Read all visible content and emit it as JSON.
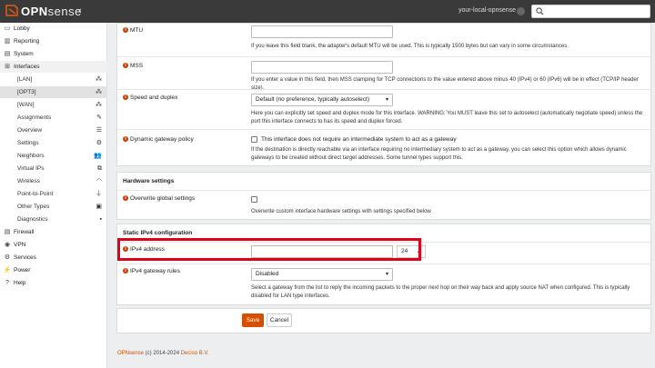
{
  "header": {
    "logo_text_bold": "OPN",
    "logo_text_thin": "sense",
    "hostname": "your-local-opnsense",
    "search_placeholder": ""
  },
  "sidebar": {
    "items": [
      {
        "label": "Lobby",
        "icon": "laptop-icon"
      },
      {
        "label": "Reporting",
        "icon": "bar-chart-icon"
      },
      {
        "label": "System",
        "icon": "server-icon"
      },
      {
        "label": "Interfaces",
        "icon": "sitemap-icon"
      },
      {
        "label": "[LAN]",
        "icon": "sitemap-icon"
      },
      {
        "label": "[OPT3]",
        "icon": "sitemap-icon"
      },
      {
        "label": "[WAN]",
        "icon": "sitemap-icon"
      },
      {
        "label": "Assignments",
        "icon": "pencil-icon"
      },
      {
        "label": "Overview",
        "icon": "tasks-icon"
      },
      {
        "label": "Settings",
        "icon": "cogs-icon"
      },
      {
        "label": "Neighbors",
        "icon": "users-icon"
      },
      {
        "label": "Virtual IPs",
        "icon": "clone-icon"
      },
      {
        "label": "Wireless",
        "icon": "wifi-icon"
      },
      {
        "label": "Point-to-Point",
        "icon": "plug-icon"
      },
      {
        "label": "Other Types",
        "icon": "archive-icon"
      },
      {
        "label": "Diagnostics",
        "icon": "medkit-icon"
      },
      {
        "label": "Firewall",
        "icon": "fire-icon"
      },
      {
        "label": "VPN",
        "icon": "globe-icon"
      },
      {
        "label": "Services",
        "icon": "cog-icon"
      },
      {
        "label": "Power",
        "icon": "plug-icon"
      },
      {
        "label": "Help",
        "icon": "help-icon"
      }
    ]
  },
  "form": {
    "mtu": {
      "label": "MTU",
      "value": "",
      "help": "If you leave this field blank, the adapter's default MTU will be used. This is typically 1500 bytes but can vary in some circumstances."
    },
    "mss": {
      "label": "MSS",
      "value": "",
      "help": "If you enter a value in this field, then MSS clamping for TCP connections to the value entered above minus 40 (IPv4) or 60 (IPv6) will be in effect (TCP/IP header size)."
    },
    "speed": {
      "label": "Speed and duplex",
      "selected": "Default (no preference, typically autoselect)",
      "help": "Here you can explicitly set speed and duplex mode for this interface. WARNING: You MUST leave this set to autoselect (automatically negotiate speed) unless the port this interface connects to has its speed and duplex forced."
    },
    "dyn_gw": {
      "label": "Dynamic gateway policy",
      "checkbox_label": "This interface does not require an intermediate system to act as a gateway",
      "help": "If the destination is directly reachable via an interface requiring no intermediary system to act as a gateway, you can select this option which allows dynamic gateways to be created without direct target addresses. Some tunnel types support this."
    },
    "hardware": {
      "title": "Hardware settings",
      "overwrite_label": "Overwrite global settings",
      "overwrite_help": "Overwrite custom interface hardware settings with settings specified below"
    },
    "ipv4": {
      "title": "Static IPv4 configuration",
      "address_label": "IPv4 address",
      "address_value": "",
      "mask": "24",
      "gw_label": "IPv4 gateway rules",
      "gw_selected": "Disabled",
      "gw_help": "Select a gateway from the list to reply the incoming packets to the proper next hop on their way back and apply source NAT when configured. This is typically disabled for LAN type interfaces."
    }
  },
  "buttons": {
    "save": "Save",
    "cancel": "Cancel"
  },
  "footer": {
    "brand": "OPNsense",
    "copyright": " (c) 2014-2024 ",
    "company": "Deciso B.V."
  },
  "colors": {
    "accent": "#d94f00",
    "highlight": "#e0001a",
    "topbar": "#3a3a3a"
  }
}
